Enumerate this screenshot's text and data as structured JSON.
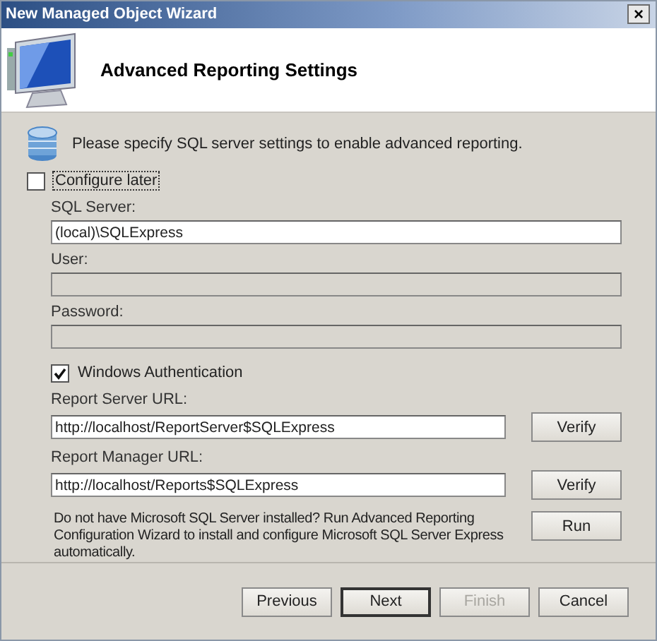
{
  "window": {
    "title": "New Managed Object Wizard",
    "close": "×"
  },
  "header": {
    "title": "Advanced Reporting Settings"
  },
  "intro": "Please specify SQL server settings to enable advanced reporting.",
  "configure_later": {
    "label": "Configure later",
    "checked": false,
    "focused": true
  },
  "fields": [
    {
      "label": "SQL Server:",
      "value": "(local)\\SQLExpress",
      "disabled": false
    },
    {
      "label": "User:",
      "disabled": true
    },
    {
      "label": "Password:",
      "disabled": true
    }
  ],
  "windows_auth": {
    "label": "Windows Authentication",
    "checked": true
  },
  "url_fields": [
    {
      "label": "Report Server URL:",
      "value": "http://localhost/ReportServer$SQLExpress",
      "button": "Verify"
    },
    {
      "label": "Report Manager URL:",
      "value": "http://localhost/Reports$SQLExpress",
      "button": "Verify"
    }
  ],
  "install_note": {
    "text": "Do not have Microsoft SQL Server installed? Run Advanced Reporting Configuration Wizard to install and configure Microsoft SQL Server Express automatically.",
    "button": "Run"
  },
  "buttons": [
    {
      "label": "Previous",
      "disabled": false,
      "default": false
    },
    {
      "label": "Next",
      "disabled": false,
      "default": true
    },
    {
      "label": "Finish",
      "disabled": true,
      "default": false
    },
    {
      "label": "Cancel",
      "disabled": false,
      "default": false
    }
  ]
}
